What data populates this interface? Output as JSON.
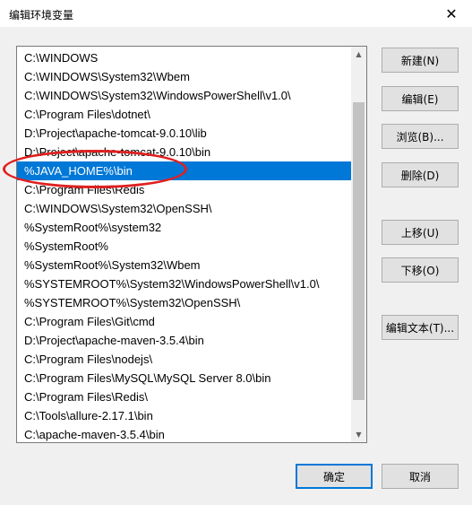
{
  "window": {
    "title": "编辑环境变量",
    "close_glyph": "✕"
  },
  "list": {
    "items": [
      "C:\\WINDOWS",
      "C:\\WINDOWS\\System32\\Wbem",
      "C:\\WINDOWS\\System32\\WindowsPowerShell\\v1.0\\",
      "C:\\Program Files\\dotnet\\",
      "D:\\Project\\apache-tomcat-9.0.10\\lib",
      "D:\\Project\\apache-tomcat-9.0.10\\bin",
      "%JAVA_HOME%\\bin",
      "C:\\Program Files\\Redis",
      "C:\\WINDOWS\\System32\\OpenSSH\\",
      "%SystemRoot%\\system32",
      "%SystemRoot%",
      "%SystemRoot%\\System32\\Wbem",
      "%SYSTEMROOT%\\System32\\WindowsPowerShell\\v1.0\\",
      "%SYSTEMROOT%\\System32\\OpenSSH\\",
      "C:\\Program Files\\Git\\cmd",
      "D:\\Project\\apache-maven-3.5.4\\bin",
      "C:\\Program Files\\nodejs\\",
      "C:\\Program Files\\MySQL\\MySQL Server 8.0\\bin",
      "C:\\Program Files\\Redis\\",
      "C:\\Tools\\allure-2.17.1\\bin",
      "C:\\apache-maven-3.5.4\\bin"
    ],
    "selected_index": 6
  },
  "buttons": {
    "new": "新建(N)",
    "edit": "编辑(E)",
    "browse": "浏览(B)...",
    "delete": "删除(D)",
    "move_up": "上移(U)",
    "move_down": "下移(O)",
    "edit_text": "编辑文本(T)...",
    "ok": "确定",
    "cancel": "取消"
  },
  "colors": {
    "selection": "#0078d7",
    "annotation": "#e02020"
  }
}
